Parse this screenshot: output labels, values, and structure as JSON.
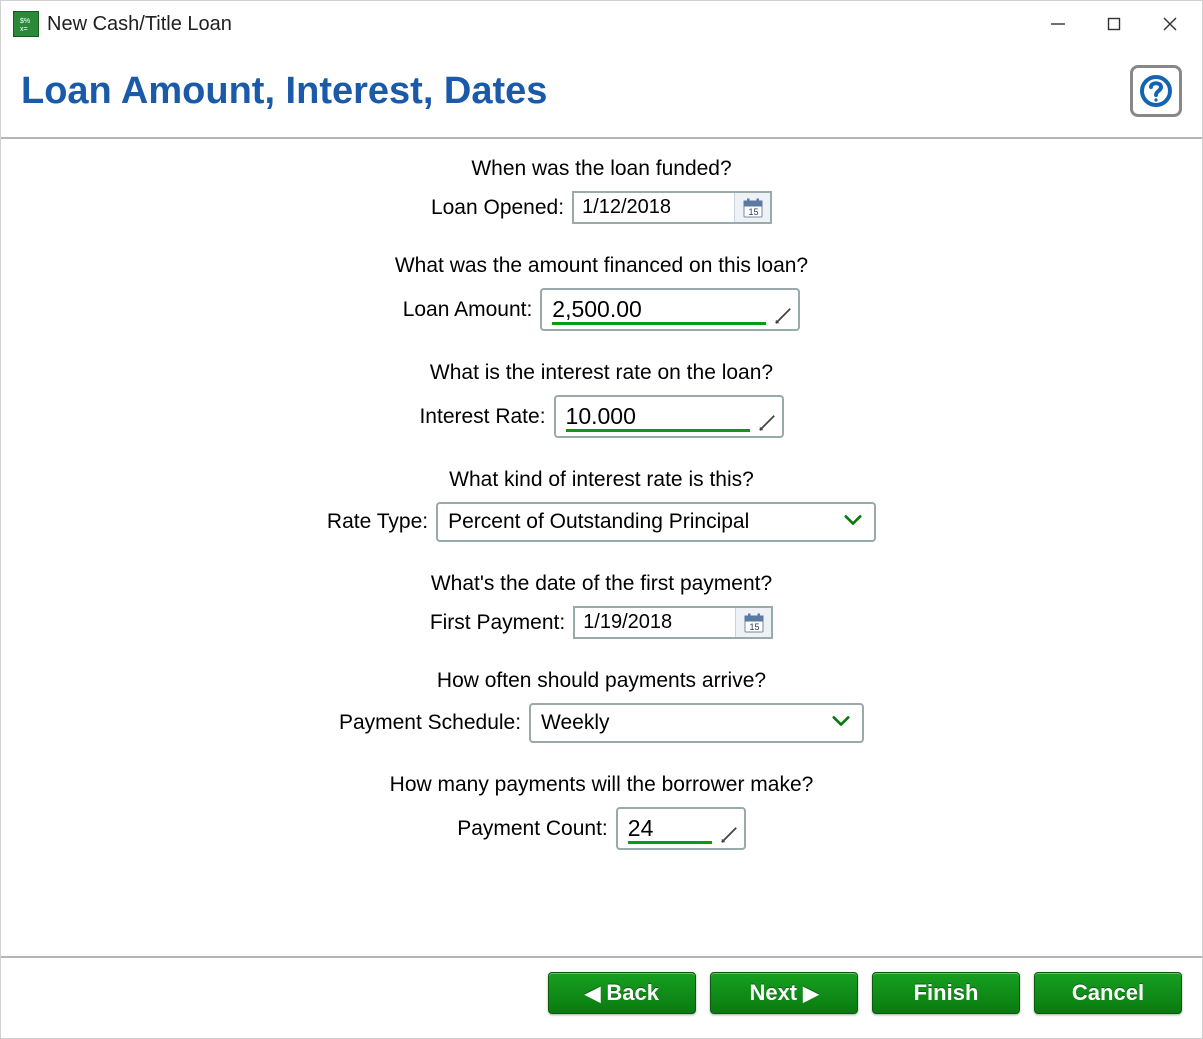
{
  "window": {
    "title": "New Cash/Title Loan"
  },
  "header": {
    "title": "Loan Amount, Interest, Dates"
  },
  "form": {
    "loan_opened": {
      "question": "When was the loan funded?",
      "label": "Loan Opened:",
      "value": "1/12/2018"
    },
    "loan_amount": {
      "question": "What was the amount financed on this loan?",
      "label": "Loan Amount:",
      "value": "2,500.00"
    },
    "interest_rate": {
      "question": "What is the interest rate on the loan?",
      "label": "Interest Rate:",
      "value": "10.000"
    },
    "rate_type": {
      "question": "What kind of interest rate is this?",
      "label": "Rate Type:",
      "value": "Percent of Outstanding Principal"
    },
    "first_payment": {
      "question": "What's the date of the first payment?",
      "label": "First Payment:",
      "value": "1/19/2018"
    },
    "payment_schedule": {
      "question": "How often should payments arrive?",
      "label": "Payment Schedule:",
      "value": "Weekly"
    },
    "payment_count": {
      "question": "How many payments will the borrower make?",
      "label": "Payment Count:",
      "value": "24"
    }
  },
  "footer": {
    "back": "Back",
    "next": "Next",
    "finish": "Finish",
    "cancel": "Cancel"
  }
}
